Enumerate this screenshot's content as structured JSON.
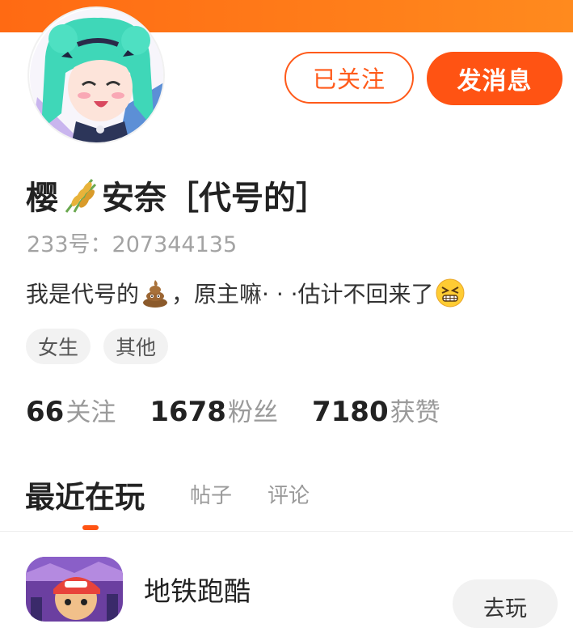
{
  "header": {
    "banner_color": "#ff7a1a"
  },
  "profile": {
    "avatar_icon": "anime-girl-avatar",
    "nickname_part1": "樱",
    "nickname_emoji": "wheat-ears-icon",
    "nickname_part2": "安奈［代号的］",
    "uid": "233号：207344135",
    "bio_part1": "我是代号的",
    "bio_emoji1": "poop-emoji",
    "bio_part2": "，原主嘛· · ·估计不回来了",
    "bio_emoji2": "grimacing-laughing-emoji",
    "tags": [
      "女生",
      "其他"
    ]
  },
  "actions": {
    "follow_label": "已关注",
    "message_label": "发消息",
    "accent_color": "#ff5313"
  },
  "stats": [
    {
      "num": "66",
      "label": "关注"
    },
    {
      "num": "1678",
      "label": "粉丝"
    },
    {
      "num": "7180",
      "label": "获赞"
    }
  ],
  "tabs": {
    "active": "最近在玩",
    "posts": "帖子",
    "comments": "评论"
  },
  "recent_games": [
    {
      "title": "地铁跑酷",
      "icon": "subway-surfers-icon",
      "button": "去玩"
    }
  ]
}
